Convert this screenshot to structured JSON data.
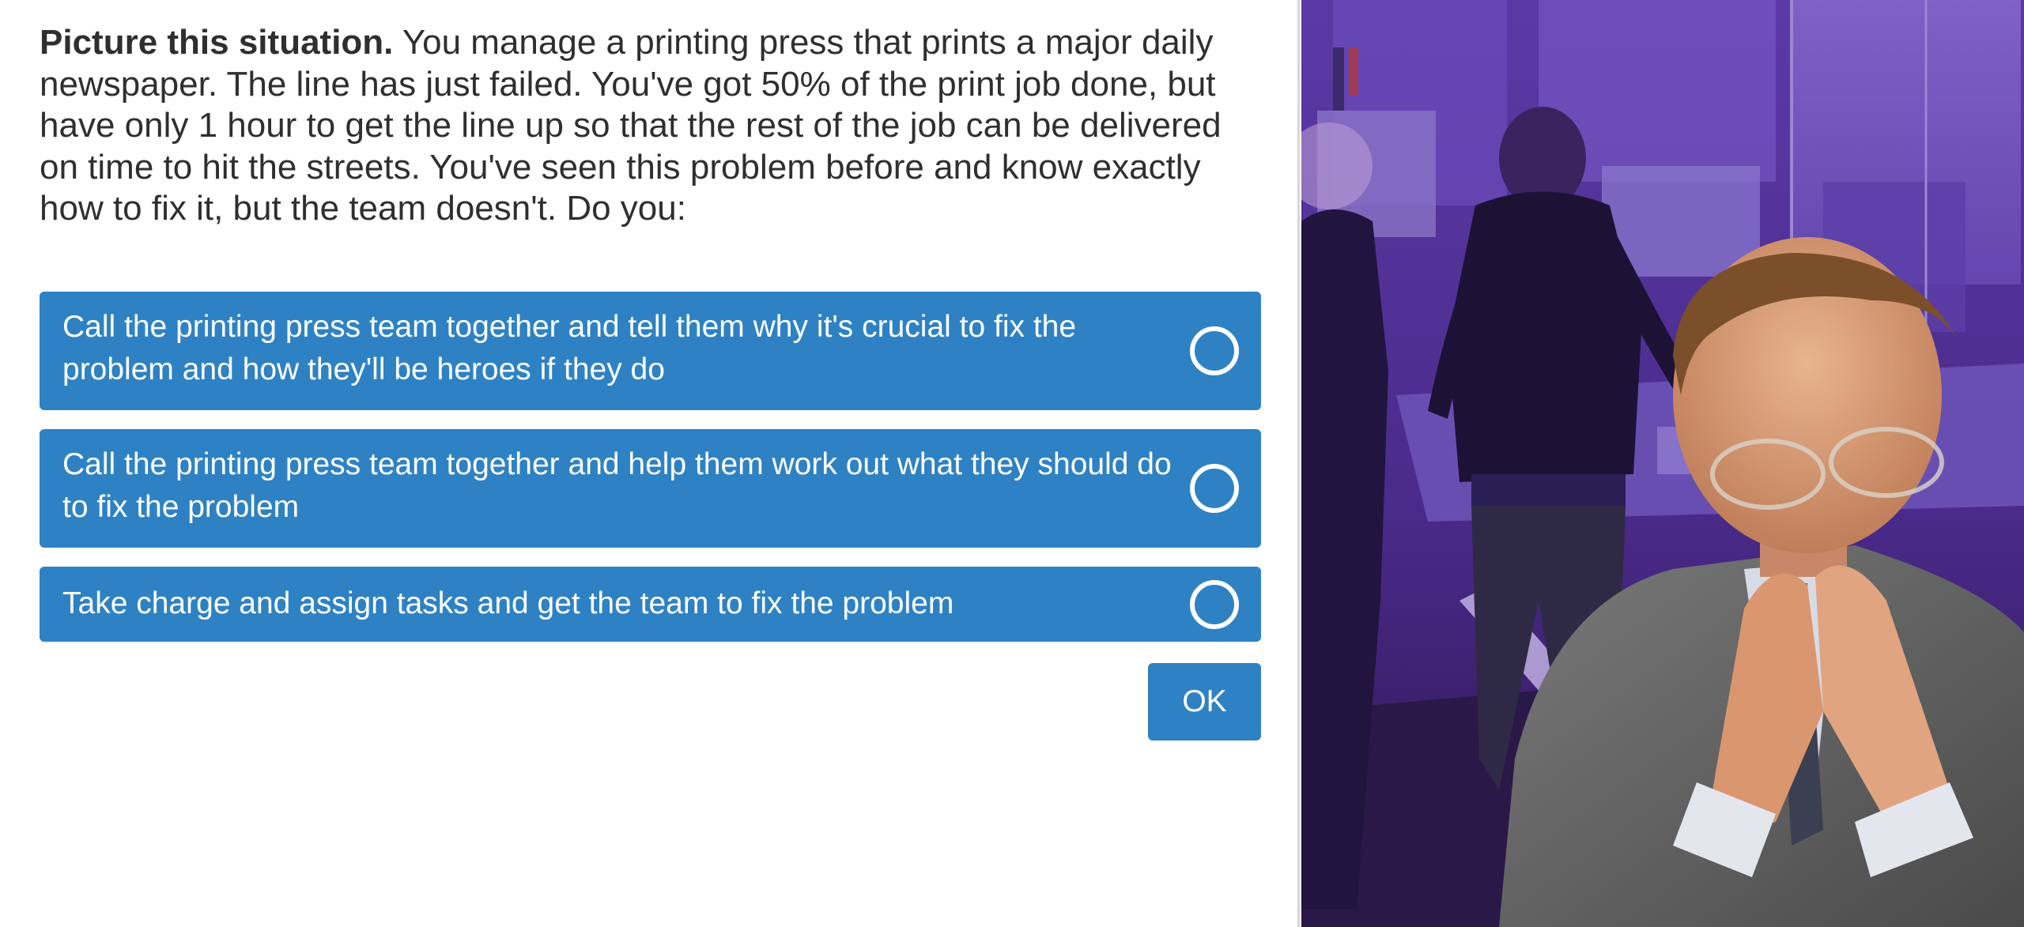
{
  "question": {
    "lead": "Picture this situation.",
    "body": " You manage a printing press that prints a major daily newspaper. The line has just failed. You've got 50% of the print job done, but have only 1 hour to get the line up so that the rest of the job can be delivered on time to hit the streets. You've seen this problem before and know exactly how to fix it, but the team doesn't. Do you:"
  },
  "options": [
    {
      "label": "Call the printing press team together and tell them why it's crucial to fix the problem and how they'll be heroes if they do",
      "selected": false
    },
    {
      "label": "Call the printing press team together and help them work out what they should do to fix the problem",
      "selected": false
    },
    {
      "label": "Take charge and assign tasks and get the team to fix the problem",
      "selected": false
    }
  ],
  "actions": {
    "ok_label": "OK"
  },
  "colors": {
    "accent": "#2e82c4",
    "text": "#2f2f2f",
    "scene_tint": "#4a2a86"
  },
  "icons": {
    "option_selector": "radio-circle-icon"
  }
}
